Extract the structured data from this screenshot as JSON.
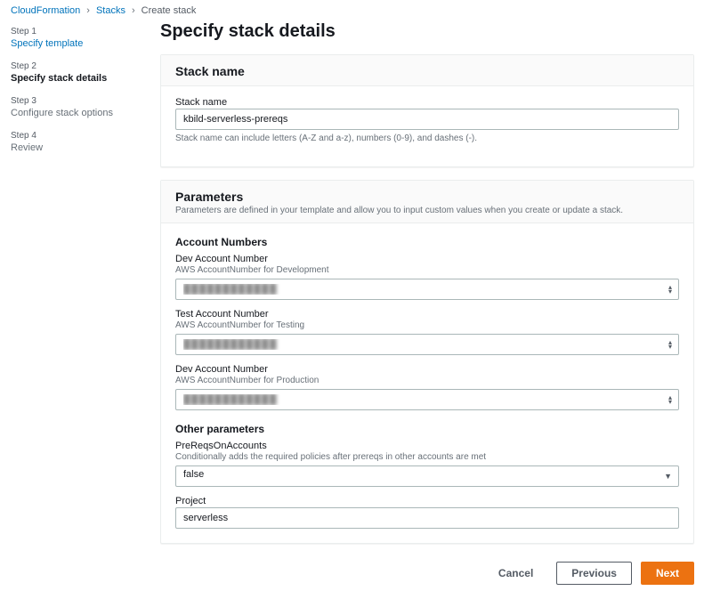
{
  "breadcrumbs": {
    "items": [
      "CloudFormation",
      "Stacks"
    ],
    "current": "Create stack"
  },
  "sidebar": {
    "steps": [
      {
        "num": "Step 1",
        "title": "Specify template"
      },
      {
        "num": "Step 2",
        "title": "Specify stack details"
      },
      {
        "num": "Step 3",
        "title": "Configure stack options"
      },
      {
        "num": "Step 4",
        "title": "Review"
      }
    ]
  },
  "page_title": "Specify stack details",
  "stack_name_panel": {
    "heading": "Stack name",
    "field_label": "Stack name",
    "value": "kbild-serverless-prereqs",
    "hint": "Stack name can include letters (A-Z and a-z), numbers (0-9), and dashes (-)."
  },
  "parameters_panel": {
    "heading": "Parameters",
    "desc": "Parameters are defined in your template and allow you to input custom values when you create or update a stack.",
    "account_section_title": "Account Numbers",
    "fields": {
      "dev": {
        "label": "Dev Account Number",
        "desc": "AWS AccountNumber for Development",
        "value": "████████████"
      },
      "test": {
        "label": "Test Account Number",
        "desc": "AWS AccountNumber for Testing",
        "value": "████████████"
      },
      "prod": {
        "label": "Dev Account Number",
        "desc": "AWS AccountNumber for Production",
        "value": "████████████"
      }
    },
    "other_section_title": "Other parameters",
    "prereqs": {
      "label": "PreReqsOnAccounts",
      "desc": "Conditionally adds the required policies after prereqs in other accounts are met",
      "value": "false"
    },
    "project": {
      "label": "Project",
      "value": "serverless"
    }
  },
  "footer": {
    "cancel": "Cancel",
    "previous": "Previous",
    "next": "Next"
  }
}
